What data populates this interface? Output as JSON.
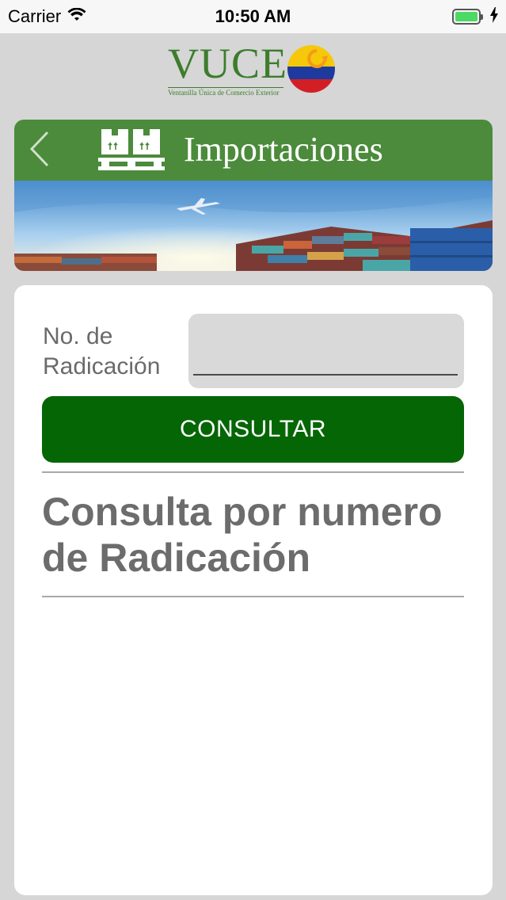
{
  "status_bar": {
    "carrier": "Carrier",
    "time": "10:50 AM"
  },
  "logo": {
    "name": "VUCE",
    "subtitle": "Ventanilla Única de Comercio Exterior"
  },
  "header": {
    "title": "Importaciones",
    "color": "#4b8b3b"
  },
  "form": {
    "label": "No. de Radicación",
    "input_value": "",
    "button_label": "CONSULTAR",
    "button_color": "#056605"
  },
  "result": {
    "title": "Consulta por numero de Radicación"
  }
}
